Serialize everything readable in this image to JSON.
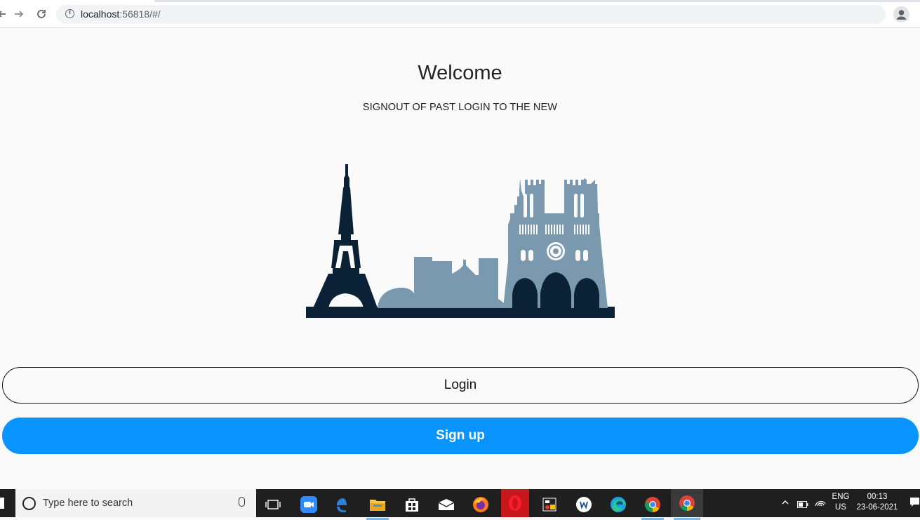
{
  "browser": {
    "url_host": "localhost",
    "url_rest": ":56818/#/"
  },
  "main": {
    "title": "Welcome",
    "subtitle": "SIGNOUT OF PAST LOGIN TO THE NEW",
    "login_label": "Login",
    "signup_label": "Sign up"
  },
  "colors": {
    "accent": "#0a94ff",
    "skyline_dark": "#0b2236",
    "skyline_light": "#7a99ae",
    "taskbar": "#1f1f1f"
  },
  "taskbar": {
    "search_placeholder": "Type here to search",
    "apps": [
      "task-view-icon",
      "zoom-icon",
      "edge-legacy-icon",
      "file-explorer-icon",
      "store-icon",
      "mail-icon",
      "firefox-icon",
      "opera-icon",
      "app-icon",
      "word-app-icon",
      "edge-icon",
      "chrome-icon",
      "chrome-active-icon"
    ],
    "lang_top": "ENG",
    "lang_bottom": "US",
    "time": "00:13",
    "date": "23-06-2021"
  }
}
